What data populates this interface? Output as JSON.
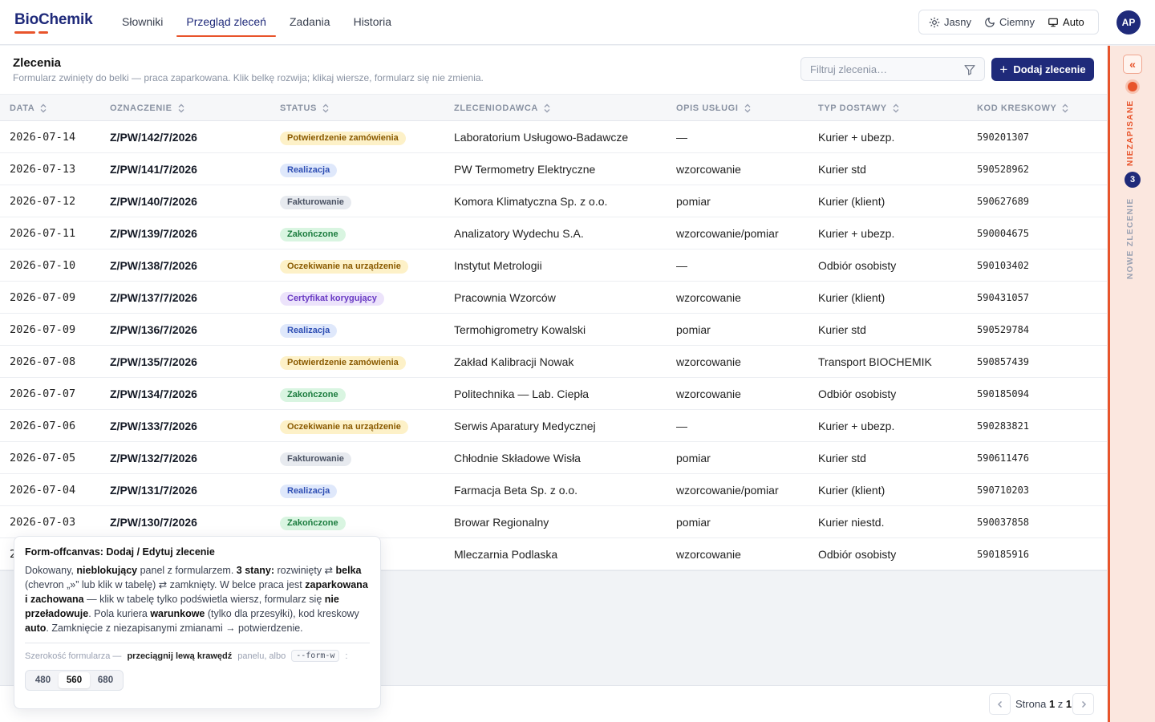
{
  "app": {
    "logo": "BioChemik",
    "nav": [
      {
        "label": "Słowniki",
        "active": false
      },
      {
        "label": "Przegląd zleceń",
        "active": true
      },
      {
        "label": "Zadania",
        "active": false
      },
      {
        "label": "Historia",
        "active": false
      }
    ],
    "theme": {
      "options": [
        {
          "label": "Jasny",
          "icon": "sun-icon"
        },
        {
          "label": "Ciemny",
          "icon": "moon-icon"
        },
        {
          "label": "Auto",
          "icon": "monitor-icon"
        }
      ],
      "selected": "Auto"
    },
    "user_initials": "AP"
  },
  "header": {
    "title": "Zlecenia",
    "subtitle": "Formularz zwinięty do belki — praca zaparkowana. Klik belkę rozwija; klikaj wiersze, formularz się nie zmienia.",
    "filter_placeholder": "Filtruj zlecenia…",
    "add_label": "Dodaj zlecenie"
  },
  "table": {
    "columns": [
      "Data",
      "Oznaczenie",
      "Status",
      "Zleceniodawca",
      "Opis usługi",
      "Typ dostawy",
      "Kod kreskowy"
    ],
    "rows": [
      {
        "date": "2026-07-14",
        "code": "Z/PW/142/7/2026",
        "status": "Potwierdzenie zamówienia",
        "status_color": "yellow",
        "client": "Laboratorium Usługowo-Badawcze",
        "desc": "—",
        "delivery": "Kurier + ubezp.",
        "barcode": "590201307"
      },
      {
        "date": "2026-07-13",
        "code": "Z/PW/141/7/2026",
        "status": "Realizacja",
        "status_color": "blue",
        "client": "PW Termometry Elektryczne",
        "desc": "wzorcowanie",
        "delivery": "Kurier std",
        "barcode": "590528962"
      },
      {
        "date": "2026-07-12",
        "code": "Z/PW/140/7/2026",
        "status": "Fakturowanie",
        "status_color": "gray",
        "client": "Komora Klimatyczna Sp. z o.o.",
        "desc": "pomiar",
        "delivery": "Kurier (klient)",
        "barcode": "590627689"
      },
      {
        "date": "2026-07-11",
        "code": "Z/PW/139/7/2026",
        "status": "Zakończone",
        "status_color": "green",
        "client": "Analizatory Wydechu S.A.",
        "desc": "wzorcowanie/pomiar",
        "delivery": "Kurier + ubezp.",
        "barcode": "590004675"
      },
      {
        "date": "2026-07-10",
        "code": "Z/PW/138/7/2026",
        "status": "Oczekiwanie na urządzenie",
        "status_color": "yellow",
        "client": "Instytut Metrologii",
        "desc": "—",
        "delivery": "Odbiór osobisty",
        "barcode": "590103402"
      },
      {
        "date": "2026-07-09",
        "code": "Z/PW/137/7/2026",
        "status": "Certyfikat korygujący",
        "status_color": "purple",
        "client": "Pracownia Wzorców",
        "desc": "wzorcowanie",
        "delivery": "Kurier (klient)",
        "barcode": "590431057"
      },
      {
        "date": "2026-07-09",
        "code": "Z/PW/136/7/2026",
        "status": "Realizacja",
        "status_color": "blue",
        "client": "Termohigrometry Kowalski",
        "desc": "pomiar",
        "delivery": "Kurier std",
        "barcode": "590529784"
      },
      {
        "date": "2026-07-08",
        "code": "Z/PW/135/7/2026",
        "status": "Potwierdzenie zamówienia",
        "status_color": "yellow",
        "client": "Zakład Kalibracji Nowak",
        "desc": "wzorcowanie",
        "delivery": "Transport BIOCHEMIK",
        "barcode": "590857439"
      },
      {
        "date": "2026-07-07",
        "code": "Z/PW/134/7/2026",
        "status": "Zakończone",
        "status_color": "green",
        "client": "Politechnika — Lab. Ciepła",
        "desc": "wzorcowanie",
        "delivery": "Odbiór osobisty",
        "barcode": "590185094"
      },
      {
        "date": "2026-07-06",
        "code": "Z/PW/133/7/2026",
        "status": "Oczekiwanie na urządzenie",
        "status_color": "yellow",
        "client": "Serwis Aparatury Medycznej",
        "desc": "—",
        "delivery": "Kurier + ubezp.",
        "barcode": "590283821"
      },
      {
        "date": "2026-07-05",
        "code": "Z/PW/132/7/2026",
        "status": "Fakturowanie",
        "status_color": "gray",
        "client": "Chłodnie Składowe Wisła",
        "desc": "pomiar",
        "delivery": "Kurier std",
        "barcode": "590611476"
      },
      {
        "date": "2026-07-04",
        "code": "Z/PW/131/7/2026",
        "status": "Realizacja",
        "status_color": "blue",
        "client": "Farmacja Beta Sp. z o.o.",
        "desc": "wzorcowanie/pomiar",
        "delivery": "Kurier (klient)",
        "barcode": "590710203"
      },
      {
        "date": "2026-07-03",
        "code": "Z/PW/130/7/2026",
        "status": "Zakończone",
        "status_color": "green",
        "client": "Browar Regionalny",
        "desc": "pomiar",
        "delivery": "Kurier niestd.",
        "barcode": "590037858"
      },
      {
        "date": "2",
        "code": "",
        "status": "",
        "status_color": "purple",
        "client": "Mleczarnia Podlaska",
        "desc": "wzorcowanie",
        "delivery": "Odbiór osobisty",
        "barcode": "590185916"
      }
    ]
  },
  "pagination": {
    "prefix": "Strona",
    "current": "1",
    "sep": "z",
    "total": "1"
  },
  "side_strip": {
    "unsaved_label": "Niezapisane",
    "count": "3",
    "new_label": "Nowe zlecenie",
    "expand_glyph": "«"
  },
  "info_card": {
    "title": "Form-offcanvas: Dodaj / Edytuj zlecenie",
    "width_prefix": "Szerokość formularza —",
    "width_action": "przeciągnij lewą krawędź",
    "width_mid": "panelu, albo",
    "width_code": "--form-w",
    "width_suffix": ":",
    "width_options": [
      "480",
      "560",
      "680"
    ],
    "width_selected": "560"
  },
  "colors": {
    "brand": "#1f2a7a",
    "accent": "#e8542b"
  }
}
